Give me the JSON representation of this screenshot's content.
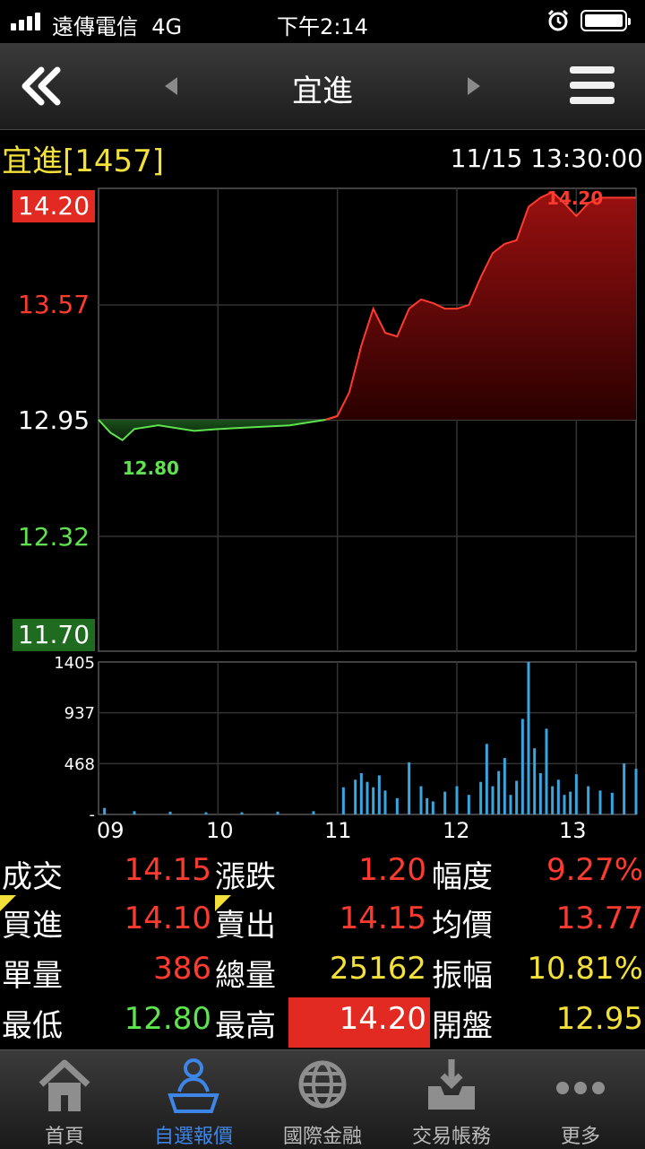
{
  "status_bar": {
    "carrier": "遠傳電信",
    "network": "4G",
    "time": "下午2:14"
  },
  "header": {
    "title": "宜進"
  },
  "stock": {
    "name_code": "宜進[1457]",
    "datetime": "11/15 13:30:00"
  },
  "chart_data": [
    {
      "type": "line",
      "y_ticks": [
        "14.20",
        "13.57",
        "12.95",
        "12.32",
        "11.70"
      ],
      "ylim": [
        11.7,
        14.2
      ],
      "reference_price": 12.95,
      "x_ticks": [
        "09",
        "10",
        "11",
        "12",
        "13"
      ],
      "annotations": [
        {
          "label": "14.20",
          "kind": "high"
        },
        {
          "label": "12.80",
          "kind": "low"
        }
      ],
      "x": [
        9.0,
        9.1,
        9.2,
        9.3,
        9.5,
        9.8,
        10.0,
        10.3,
        10.6,
        10.9,
        11.0,
        11.1,
        11.2,
        11.3,
        11.4,
        11.5,
        11.6,
        11.7,
        11.8,
        11.9,
        12.0,
        12.1,
        12.2,
        12.3,
        12.4,
        12.5,
        12.6,
        12.7,
        12.8,
        12.9,
        13.0,
        13.1,
        13.2,
        13.3,
        13.5
      ],
      "values": [
        12.95,
        12.88,
        12.84,
        12.9,
        12.92,
        12.89,
        12.9,
        12.91,
        12.92,
        12.95,
        12.97,
        13.1,
        13.35,
        13.55,
        13.42,
        13.4,
        13.55,
        13.6,
        13.58,
        13.55,
        13.55,
        13.57,
        13.72,
        13.85,
        13.9,
        13.92,
        14.1,
        14.15,
        14.18,
        14.12,
        14.05,
        14.12,
        14.15,
        14.15,
        14.15
      ]
    },
    {
      "type": "bar",
      "y_ticks": [
        "1405",
        "937",
        "468"
      ],
      "ylim": [
        0,
        1405
      ],
      "x_ticks": [
        "09",
        "10",
        "11",
        "12",
        "13"
      ],
      "x": [
        9.05,
        9.3,
        9.6,
        9.9,
        10.2,
        10.5,
        10.8,
        11.05,
        11.15,
        11.2,
        11.25,
        11.3,
        11.35,
        11.4,
        11.5,
        11.6,
        11.7,
        11.75,
        11.8,
        11.9,
        12.0,
        12.1,
        12.2,
        12.25,
        12.3,
        12.35,
        12.4,
        12.45,
        12.5,
        12.55,
        12.6,
        12.65,
        12.7,
        12.75,
        12.8,
        12.85,
        12.9,
        12.95,
        13.0,
        13.1,
        13.2,
        13.3,
        13.4,
        13.5
      ],
      "values": [
        60,
        30,
        25,
        20,
        20,
        25,
        30,
        250,
        320,
        380,
        300,
        250,
        360,
        220,
        150,
        480,
        260,
        150,
        120,
        210,
        260,
        180,
        300,
        650,
        260,
        400,
        520,
        180,
        310,
        880,
        1405,
        610,
        380,
        790,
        260,
        320,
        180,
        210,
        370,
        260,
        220,
        200,
        470,
        420
      ]
    }
  ],
  "quote": {
    "trade_label": "成交",
    "trade_value": "14.15",
    "change_label": "漲跌",
    "change_value": "1.20",
    "pct_label": "幅度",
    "pct_value": "9.27%",
    "bid_label": "買進",
    "bid_value": "14.10",
    "ask_label": "賣出",
    "ask_value": "14.15",
    "avg_label": "均價",
    "avg_value": "13.77",
    "unit_vol_label": "單量",
    "unit_vol_value": "386",
    "total_vol_label": "總量",
    "total_vol_value": "25162",
    "amp_label": "振幅",
    "amp_value": "10.81%",
    "low_label": "最低",
    "low_value": "12.80",
    "high_label": "最高",
    "high_value": "14.20",
    "open_label": "開盤",
    "open_value": "12.95"
  },
  "colors": {
    "up": "#ff3b30",
    "down": "#5fe34f",
    "yellow": "#f3e03a",
    "volume": "#3aa6e0"
  },
  "tabs": [
    {
      "label": "首頁",
      "icon": "home-icon"
    },
    {
      "label": "自選報價",
      "icon": "user-desk-icon",
      "active": true
    },
    {
      "label": "國際金融",
      "icon": "globe-icon"
    },
    {
      "label": "交易帳務",
      "icon": "inbox-download-icon"
    },
    {
      "label": "更多",
      "icon": "more-icon"
    }
  ]
}
